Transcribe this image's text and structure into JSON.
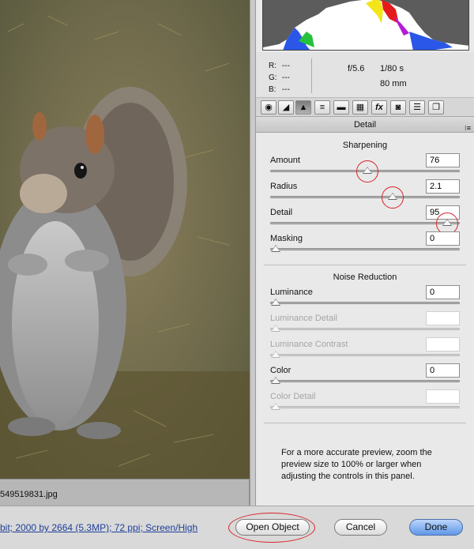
{
  "image": {
    "filename": "549519831.jpg",
    "subject": "squirrel-photo"
  },
  "readout": {
    "r_label": "R:",
    "r_value": "---",
    "g_label": "G:",
    "g_value": "---",
    "b_label": "B:",
    "b_value": "---",
    "aperture": "f/5.6",
    "shutter": "1/80 s",
    "focal_length": "80 mm"
  },
  "tabs": [
    {
      "icon": "aperture-icon",
      "glyph": "◉"
    },
    {
      "icon": "tone-curve-icon",
      "glyph": "◢"
    },
    {
      "icon": "detail-icon",
      "glyph": "▲",
      "active": true
    },
    {
      "icon": "hsl-icon",
      "glyph": "≡"
    },
    {
      "icon": "split-toning-icon",
      "glyph": "▬"
    },
    {
      "icon": "lens-corrections-icon",
      "glyph": "▦"
    },
    {
      "icon": "effects-icon",
      "glyph": "fx"
    },
    {
      "icon": "camera-calibration-icon",
      "glyph": "◙"
    },
    {
      "icon": "presets-icon",
      "glyph": "☰"
    },
    {
      "icon": "snapshots-icon",
      "glyph": "❐"
    }
  ],
  "panel": {
    "title": "Detail",
    "menu_glyph": "⁝≡"
  },
  "sharpening": {
    "title": "Sharpening",
    "controls": [
      {
        "label": "Amount",
        "value": "76",
        "fraction": 0.507,
        "highlighted": true
      },
      {
        "label": "Radius",
        "value": "2.1",
        "fraction": 0.65,
        "highlighted": true
      },
      {
        "label": "Detail",
        "value": "95",
        "fraction": 0.95,
        "highlighted": true
      },
      {
        "label": "Masking",
        "value": "0",
        "fraction": 0.0,
        "highlighted": false
      }
    ]
  },
  "noise_reduction": {
    "title": "Noise Reduction",
    "controls": [
      {
        "label": "Luminance",
        "value": "0",
        "fraction": 0.0,
        "enabled": true
      },
      {
        "label": "Luminance Detail",
        "value": "",
        "fraction": 0.0,
        "enabled": false
      },
      {
        "label": "Luminance Contrast",
        "value": "",
        "fraction": 0.0,
        "enabled": false
      },
      {
        "label": "Color",
        "value": "0",
        "fraction": 0.0,
        "enabled": true
      },
      {
        "label": "Color Detail",
        "value": "",
        "fraction": 0.0,
        "enabled": false
      }
    ]
  },
  "note": "For a more accurate preview, zoom the preview size to 100% or larger when adjusting the controls in this panel.",
  "bottom_bar": {
    "workflow_text": "bit; 2000 by 2664 (5.3MP); 72 ppi; Screen/High",
    "open_label": "Open Object",
    "cancel_label": "Cancel",
    "done_label": "Done"
  },
  "colors": {
    "accent_ring": "#d8232a",
    "done_button": "#5f97e8",
    "link": "#1f3f9a"
  }
}
